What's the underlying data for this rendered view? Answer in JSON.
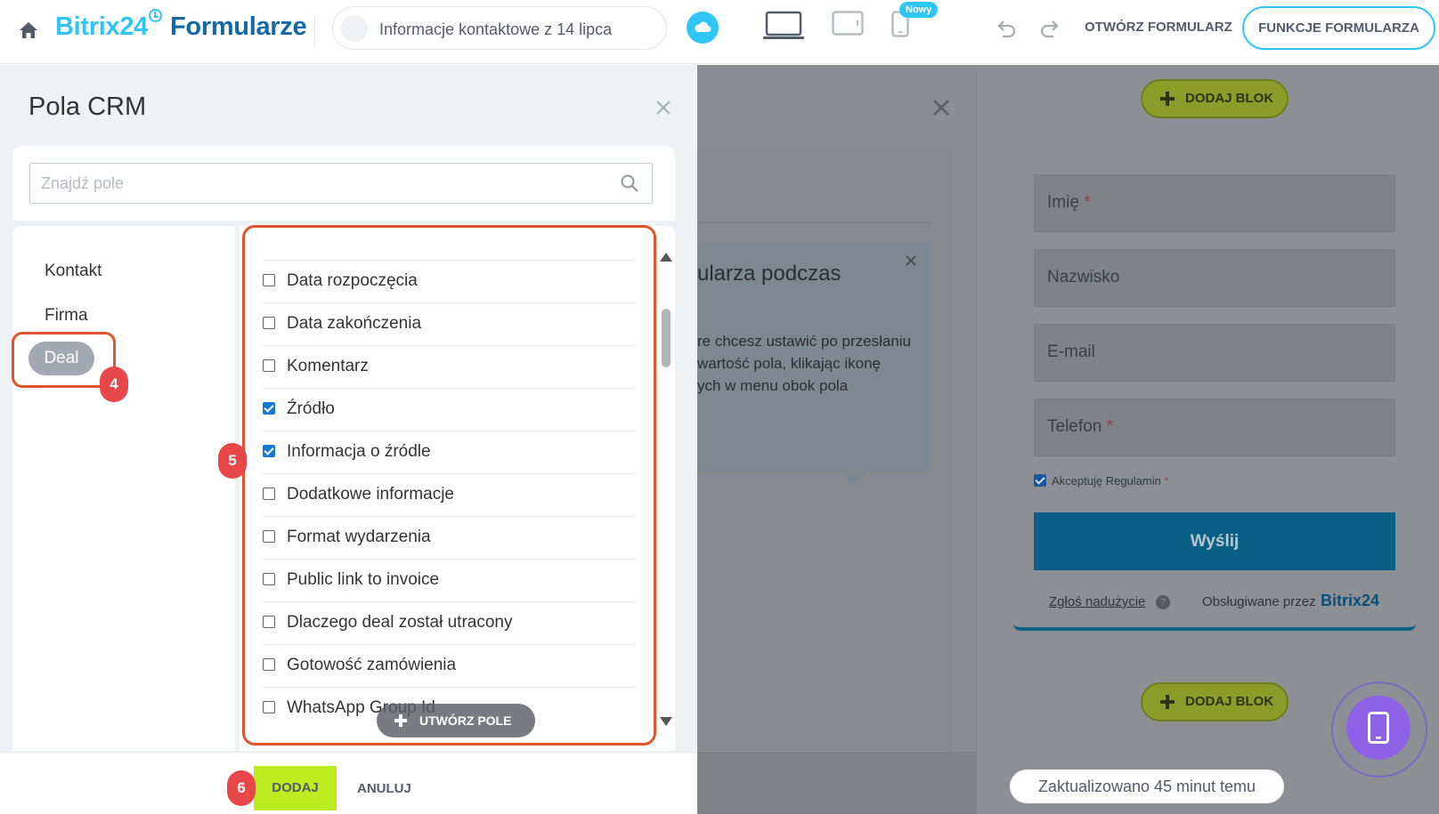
{
  "header": {
    "logo_brand": "Bitrix24",
    "logo_product": "Formularze",
    "form_name": "Informacje kontaktowe z 14 lipca",
    "new_badge": "Nowy",
    "open_form_label": "OTWÓRZ FORMULARZ",
    "features_label": "FUNKCJE FORMULARZA"
  },
  "crm_panel": {
    "title": "Pola CRM",
    "search_placeholder": "Znajdź pole",
    "categories": [
      {
        "label": "Kontakt",
        "selected": false
      },
      {
        "label": "Firma",
        "selected": false
      },
      {
        "label": "Deal",
        "selected": true
      }
    ],
    "fields": [
      {
        "label": "Data rozpoczęcia",
        "checked": false
      },
      {
        "label": "Data zakończenia",
        "checked": false
      },
      {
        "label": "Komentarz",
        "checked": false
      },
      {
        "label": "Źródło",
        "checked": true
      },
      {
        "label": "Informacja o źródle",
        "checked": true
      },
      {
        "label": "Dodatkowe informacje",
        "checked": false
      },
      {
        "label": "Format wydarzenia",
        "checked": false
      },
      {
        "label": "Public link to invoice",
        "checked": false
      },
      {
        "label": "Dlaczego deal został utracony",
        "checked": false
      },
      {
        "label": "Gotowość zamówienia",
        "checked": false
      },
      {
        "label": "WhatsApp Group Id",
        "checked": false
      }
    ],
    "create_field_label": "UTWÓRZ POLE",
    "add_label": "DODAJ",
    "cancel_label": "ANULUJ"
  },
  "tip": {
    "title": "ularza podczas",
    "lines": [
      "re chcesz ustawić po przesłaniu",
      "wartość pola, klikając ikonę",
      "ych w menu obok pola"
    ]
  },
  "preview": {
    "add_block_label": "DODAJ BLOK",
    "fields": [
      {
        "label": "Imię",
        "required": "*"
      },
      {
        "label": "Nazwisko",
        "required": ""
      },
      {
        "label": "E-mail",
        "required": ""
      },
      {
        "label": "Telefon",
        "required": "*"
      }
    ],
    "consent_label": "Akceptuję Regulamin",
    "consent_required": "*",
    "send_label": "Wyślij",
    "report_abuse": "Zgłoś nadużycie",
    "help_glyph": "?",
    "powered_by": "Obsługiwane przez",
    "powered_brand": "Bitrix24",
    "updated": "Zaktualizowano 45 minut temu"
  },
  "annotations": {
    "step_deal": "4",
    "step_fields": "5",
    "step_add": "6"
  },
  "colors": {
    "accent": "#2fc6f6",
    "highlight": "#e2542b",
    "step_badge": "#e8474a",
    "add_button": "#bbed21",
    "checkbox_checked": "#1679d4"
  }
}
